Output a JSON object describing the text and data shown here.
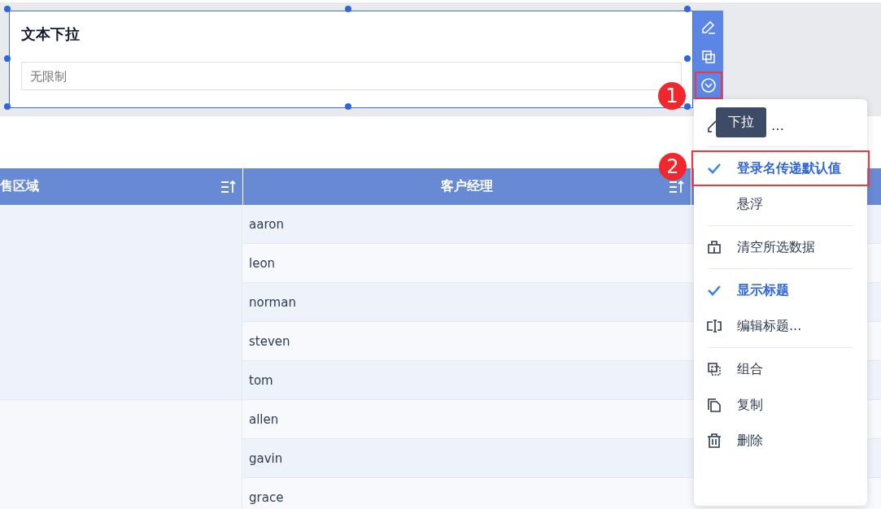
{
  "widget": {
    "title": "文本下拉",
    "field": {
      "placeholder": "无限制"
    }
  },
  "toolbar": [
    {
      "kind": "edit",
      "outlined": false
    },
    {
      "kind": "copy",
      "outlined": false
    },
    {
      "kind": "dropdown",
      "outlined": true
    }
  ],
  "tooltip": "下拉",
  "callouts": [
    "1",
    "2"
  ],
  "table": {
    "columns": [
      {
        "label": "售区域"
      },
      {
        "label": "客户经理"
      }
    ],
    "groups": [
      {
        "rows": [
          {
            "manager": "aaron"
          },
          {
            "manager": "leon"
          },
          {
            "manager": "norman"
          },
          {
            "manager": "steven"
          },
          {
            "manager": "tom"
          }
        ]
      },
      {
        "rows": [
          {
            "manager": "allen"
          },
          {
            "manager": "gavin"
          },
          {
            "manager": "grace"
          }
        ]
      }
    ]
  },
  "menu": {
    "sections": [
      {
        "items": [
          {
            "kind": "edit",
            "label": "…",
            "outlined": false
          }
        ]
      },
      {
        "items": [
          {
            "kind": "toggle",
            "label": "登录名传递默认值",
            "checked": true,
            "outlined": true
          },
          {
            "kind": "toggle",
            "label": "悬浮",
            "checked": false,
            "outlined": false
          }
        ]
      },
      {
        "items": [
          {
            "kind": "clear",
            "label": "清空所选数据",
            "outlined": false
          }
        ]
      },
      {
        "items": [
          {
            "kind": "toggle",
            "label": "显示标题",
            "checked": true,
            "outlined": false
          },
          {
            "kind": "rename",
            "label": "编辑标题...",
            "outlined": false
          }
        ]
      },
      {
        "items": [
          {
            "kind": "group",
            "label": "组合",
            "outlined": false
          },
          {
            "kind": "copy",
            "label": "复制",
            "outlined": false
          },
          {
            "kind": "delete",
            "label": "删除",
            "outlined": false
          }
        ]
      }
    ]
  }
}
